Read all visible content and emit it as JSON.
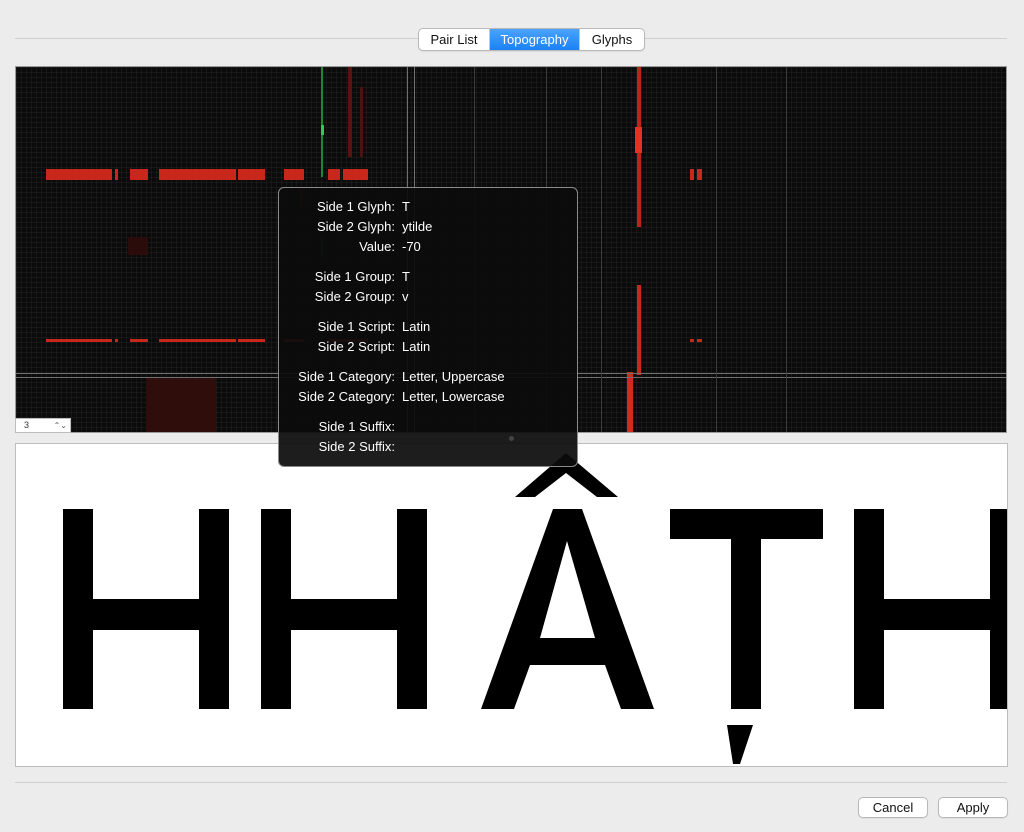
{
  "tabs": [
    {
      "label": "Pair List",
      "active": false
    },
    {
      "label": "Topography",
      "active": true
    },
    {
      "label": "Glyphs",
      "active": false
    }
  ],
  "zoom_stepper": {
    "value": "3"
  },
  "tooltip": {
    "rows": [
      {
        "label": "Side 1 Glyph:",
        "value": "T"
      },
      {
        "label": "Side 2 Glyph:",
        "value": "ytilde"
      },
      {
        "label": "Value:",
        "value": "-70"
      },
      {
        "label": "Side 1 Group:",
        "value": "T"
      },
      {
        "label": "Side 2 Group:",
        "value": "v"
      },
      {
        "label": "Side 1 Script:",
        "value": "Latin"
      },
      {
        "label": "Side 2 Script:",
        "value": "Latin"
      },
      {
        "label": "Side 1 Category:",
        "value": "Letter, Uppercase"
      },
      {
        "label": "Side 2 Category:",
        "value": "Letter, Lowercase"
      },
      {
        "label": "Side 1 Suffix:",
        "value": ""
      },
      {
        "label": "Side 2 Suffix:",
        "value": ""
      }
    ]
  },
  "preview": {
    "glyph_names": [
      "H",
      "H",
      "Acircumflex",
      "Tcommabelow",
      "H"
    ]
  },
  "buttons": {
    "cancel": "Cancel",
    "apply": "Apply"
  },
  "colors": {
    "active_tab": "#1a82f7",
    "kern_negative": "#c8281c",
    "kern_positive": "#1a8a32",
    "grid_background": "#0b0b0b"
  }
}
